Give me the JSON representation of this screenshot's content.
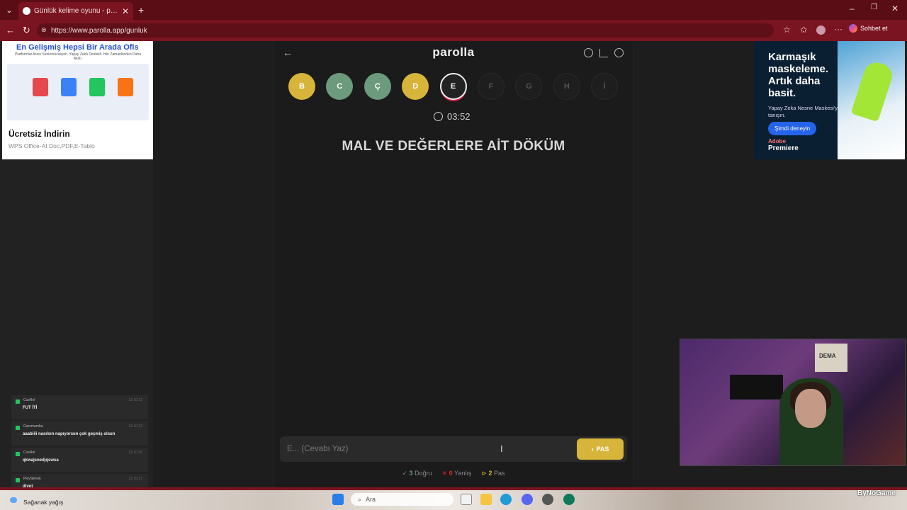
{
  "browser": {
    "tab_title": "Günlük kelime oyunu - parolla - K",
    "url": "https://www.parolla.app/gunluk",
    "sohbet_label": "Sohbet et"
  },
  "left_ad": {
    "headline": "En Gelişmiş Hepsi Bir Arada Ofis",
    "subline": "Platformlar Arası Senkronizasyon. Yapay Zekâ Destekli. Her Zamankinden Daha Akıllı.",
    "cta": "Ücretsiz İndirin",
    "description": "WPS Office-AI Doc,PDF,E-Tablo"
  },
  "right_ad": {
    "headline": "Karmaşık maskeleme. Artık daha basit.",
    "body": "Yapay Zeka Nesne Maskesi'yle tanışın.",
    "button": "Şimdi deneyin",
    "brand_top": "Adobe",
    "brand_bottom": "Premiere"
  },
  "app": {
    "logo": "parolla",
    "letters": [
      {
        "l": "B",
        "state": "yellow"
      },
      {
        "l": "C",
        "state": "green"
      },
      {
        "l": "Ç",
        "state": "green"
      },
      {
        "l": "D",
        "state": "yellow"
      },
      {
        "l": "E",
        "state": "current"
      },
      {
        "l": "F",
        "state": "future"
      },
      {
        "l": "G",
        "state": "future"
      },
      {
        "l": "H",
        "state": "future"
      },
      {
        "l": "İ",
        "state": "future"
      }
    ],
    "timer": "03:52",
    "question": "MAL VE DEĞERLERE AİT DÖKÜM",
    "answer_placeholder": "E... (Cevabı Yaz)",
    "pas_label": "PAS",
    "stats": {
      "correct_count": "3",
      "correct_label": "Doğru",
      "wrong_count": "0",
      "wrong_label": "Yanlış",
      "pass_count": "2",
      "pass_label": "Pas"
    }
  },
  "chat": [
    {
      "user": "CusRel",
      "time": "22:10:22",
      "msg": "FUT İTİ"
    },
    {
      "user": "Garsmamba",
      "time": "22:10:33",
      "msg": "aaabiiii nasılsın napıyorsun çok geçmiş olsun"
    },
    {
      "user": "CusRel",
      "time": "22:10:36",
      "msg": "qkwajsnedjqswsa"
    },
    {
      "user": "PlevSlimek",
      "time": "22:10:37",
      "msg": "diyot"
    }
  ],
  "webcam": {
    "poster_text": "DEMA"
  },
  "taskbar": {
    "weather": "Sağanak yağış",
    "search": "Ara",
    "brand": "ByNoGame"
  },
  "colors": {
    "browser_dark": "#5a0d15",
    "browser": "#7a1420",
    "correct": "#6c9a7c",
    "pass": "#d7b53a",
    "wrong": "#dc2626"
  }
}
